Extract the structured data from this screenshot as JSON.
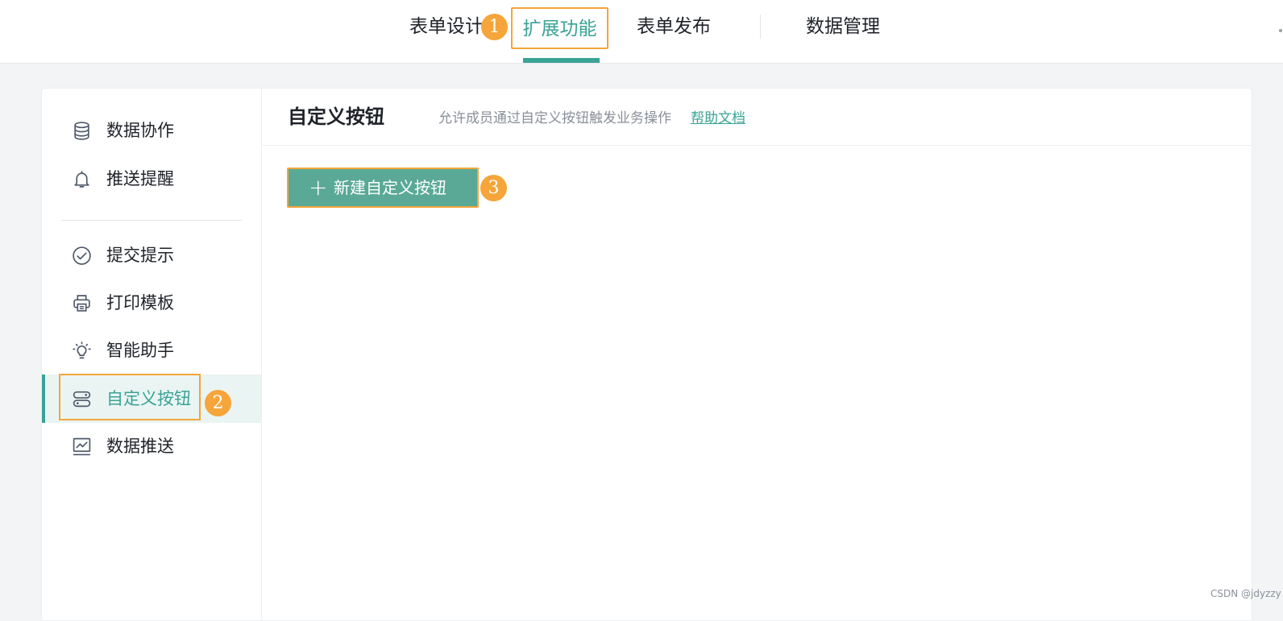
{
  "topnav": {
    "tabs": [
      {
        "label": "表单设计"
      },
      {
        "label": "扩展功能"
      },
      {
        "label": "表单发布"
      },
      {
        "label": "数据管理"
      }
    ],
    "active": "扩展功能"
  },
  "markers": [
    "1",
    "2",
    "3"
  ],
  "sidebar": {
    "items": [
      {
        "label": "数据协作",
        "icon": "database-icon"
      },
      {
        "label": "推送提醒",
        "icon": "bell-icon"
      },
      {
        "label": "提交提示",
        "icon": "check-circle-icon"
      },
      {
        "label": "打印模板",
        "icon": "printer-icon"
      },
      {
        "label": "智能助手",
        "icon": "lightbulb-icon"
      },
      {
        "label": "自定义按钮",
        "icon": "toggle-buttons-icon",
        "active": true
      },
      {
        "label": "数据推送",
        "icon": "line-chart-icon"
      }
    ]
  },
  "main": {
    "title": "自定义按钮",
    "subtitle": "允许成员通过自定义按钮触发业务操作",
    "help_link": "帮助文档",
    "new_button_plus": "+",
    "new_button": "新建自定义按钮"
  },
  "watermark": "CSDN @jdyzzy",
  "colors": {
    "accent": "#3aa396",
    "highlight": "#f5a53a",
    "button": "#5aa996"
  }
}
